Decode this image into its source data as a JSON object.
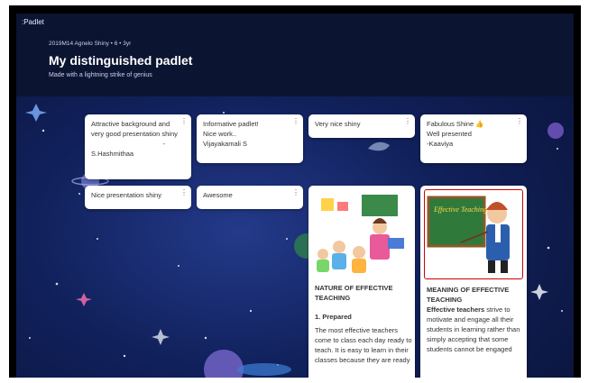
{
  "app": {
    "brand": ":Padlet"
  },
  "padlet": {
    "meta": "2019M14 Agnelo Shiny • 6 • 3yr",
    "title": "My distinguished padlet",
    "subtitle": "Made with a lightning strike of genius"
  },
  "cards": {
    "c1": {
      "l1": "Attractive background and",
      "l2": "very good presentation shiny",
      "l3": "-",
      "l4": "S.Hashmithaa"
    },
    "c2": {
      "l1": "Informative padlet!",
      "l2": "Nice work..",
      "l3": "Vijayakamali S"
    },
    "c3": {
      "l1": "Very nice shiny"
    },
    "c4": {
      "l1": "Fabulous Shine 👍",
      "l2": "Well presented",
      "l3": "-Kaaviya"
    },
    "c5": {
      "l1": "Nice presentation shiny"
    },
    "c6": {
      "l1": "Awesome"
    },
    "c7": {
      "title1": "NATURE OF EFFECTIVE",
      "title2": "TEACHING",
      "heading": "1. Prepared",
      "b1": "The most effective teachers",
      "b2": "come to class each day ready to",
      "b3": "teach. It is easy to learn in their",
      "b4": "classes because they are ready"
    },
    "c8": {
      "board": "Effective Teaching",
      "title1": "MEANING OF EFFECTIVE",
      "title2": "TEACHING",
      "bold": "Effective teachers",
      "b1r": " strive to",
      "b2": "motivate and engage all their",
      "b3": "students in learning rather than",
      "b4": "simply accepting that some",
      "b5": "students cannot be engaged"
    }
  },
  "menu_glyph": "⋮",
  "colors": {
    "header": "#0b1430",
    "space": "#10205a"
  }
}
